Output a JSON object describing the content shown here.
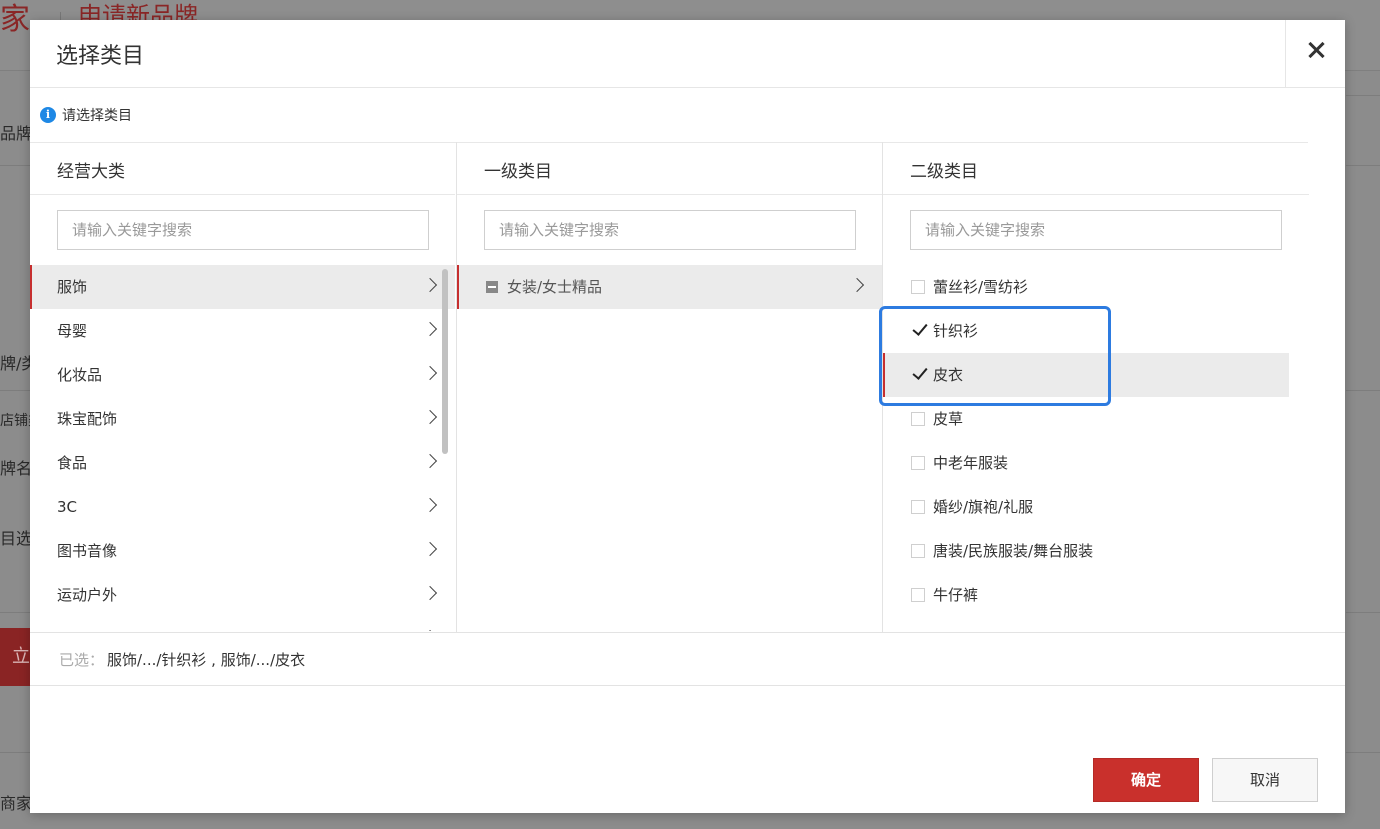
{
  "background": {
    "brand": "家",
    "title": "申请新品牌",
    "snippets": [
      "品牌",
      "牌/类",
      "店铺类",
      "牌名",
      "目选",
      "立",
      "商家"
    ]
  },
  "modal": {
    "title": "选择类目",
    "tip": "请选择类目",
    "columns": [
      {
        "header": "经营大类",
        "placeholder": "请输入关键字搜索",
        "items": [
          "服饰",
          "母婴",
          "化妆品",
          "珠宝配饰",
          "食品",
          "3C",
          "图书音像",
          "运动户外",
          "家居用品"
        ],
        "active": "服饰"
      },
      {
        "header": "一级类目",
        "placeholder": "请输入关键字搜索",
        "items": [
          "女装/女士精品"
        ]
      },
      {
        "header": "二级类目",
        "placeholder": "请输入关键字搜索",
        "items": [
          {
            "label": "蕾丝衫/雪纺衫",
            "checked": false
          },
          {
            "label": "针织衫",
            "checked": true
          },
          {
            "label": "皮衣",
            "checked": true
          },
          {
            "label": "皮草",
            "checked": false
          },
          {
            "label": "中老年服装",
            "checked": false
          },
          {
            "label": "婚纱/旗袍/礼服",
            "checked": false
          },
          {
            "label": "唐装/民族服装/舞台服装",
            "checked": false
          },
          {
            "label": "牛仔裤",
            "checked": false
          }
        ]
      }
    ],
    "selected_label": "已选：",
    "selected_value": "服饰/.../针织衫 , 服饰/.../皮衣",
    "confirm": "确定",
    "cancel": "取消"
  },
  "colors": {
    "accent_red": "#c9302c",
    "highlight_blue": "#2d7be0",
    "info_blue": "#1e88e5"
  }
}
